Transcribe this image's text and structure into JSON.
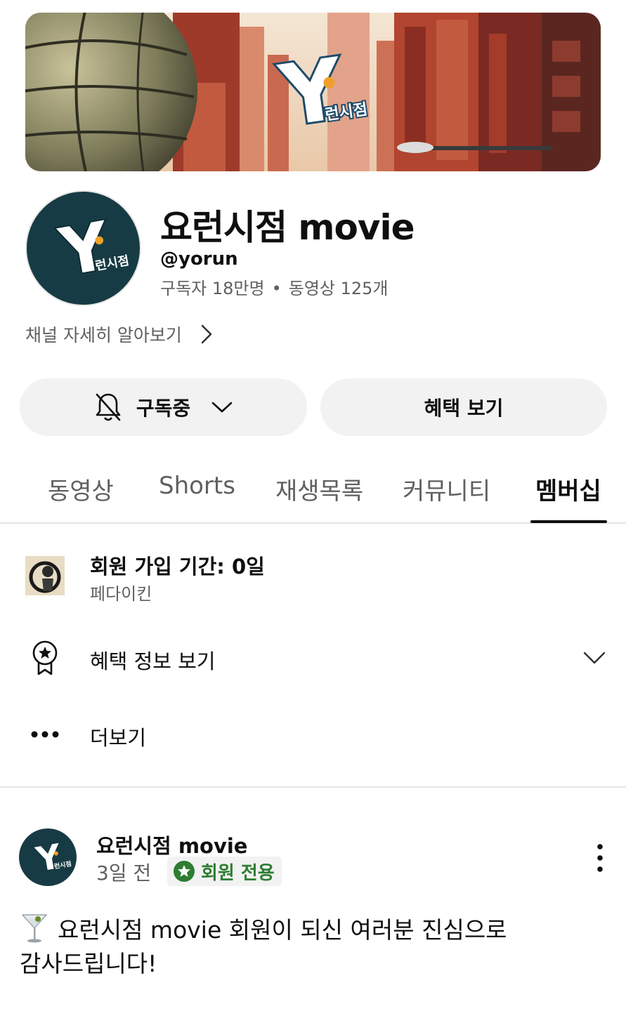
{
  "banner": {
    "logo_text": "Y",
    "logo_sub": "런시점",
    "logo_o": "o"
  },
  "channel": {
    "name": "요런시점 movie",
    "handle": "@yorun",
    "subscribers": "구독자 18만명",
    "separator": "•",
    "videos": "동영상 125개",
    "more_about": "채널 자세히 알아보기"
  },
  "actions": {
    "subscribed_label": "구독중",
    "perks_label": "혜택 보기"
  },
  "tabs": [
    {
      "label": "동영상",
      "active": false
    },
    {
      "label": "Shorts",
      "active": false
    },
    {
      "label": "재생목록",
      "active": false
    },
    {
      "label": "커뮤니티",
      "active": false
    },
    {
      "label": "멤버십",
      "active": true
    }
  ],
  "membership": {
    "duration": "회원 가입 기간: 0일",
    "level": "페다이킨",
    "perks_info": "혜택 정보 보기",
    "more": "더보기"
  },
  "post": {
    "author": "요런시점 movie",
    "time": "3일 전",
    "badge": "회원 전용",
    "text": "요런시점 movie 회원이 되신 여러분 진심으로 감사드립니다!"
  },
  "colors": {
    "accent_green": "#2e7d32",
    "avatar_bg": "#173b44",
    "gray_text": "#606060"
  },
  "icons": [
    "bell-off-icon",
    "chevron-down-icon",
    "chevron-right-icon",
    "award-star-icon",
    "more-dots-icon",
    "kebab-menu-icon",
    "star-badge-icon",
    "cocktail-glass-icon"
  ]
}
